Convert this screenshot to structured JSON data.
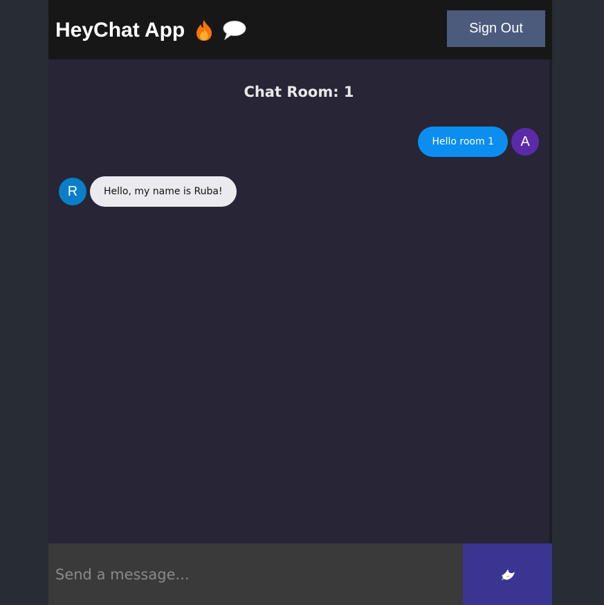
{
  "header": {
    "title": "HeyChat App",
    "icons": [
      "fire-icon",
      "speech-bubble-icon"
    ],
    "sign_out_label": "Sign Out"
  },
  "room": {
    "title": "Chat Room: 1"
  },
  "messages": [
    {
      "type": "sent",
      "avatar_initial": "A",
      "text": "Hello room 1"
    },
    {
      "type": "received",
      "avatar_initial": "R",
      "text": "Hello, my name is Ruba!"
    }
  ],
  "composer": {
    "placeholder": "Send a message...",
    "send_icon": "dove-icon"
  },
  "colors": {
    "page_bg": "#282c34",
    "app_bg": "#272536",
    "header_bg": "#181717",
    "sign_out_bg": "#4c5b7c",
    "sent_bubble": "#0b8ef0",
    "sent_avatar": "#5b2aa8",
    "received_bubble": "#ebebef",
    "received_avatar": "#0a7ec8",
    "input_bg": "#3a3a3a",
    "send_bg": "#3a3590"
  }
}
